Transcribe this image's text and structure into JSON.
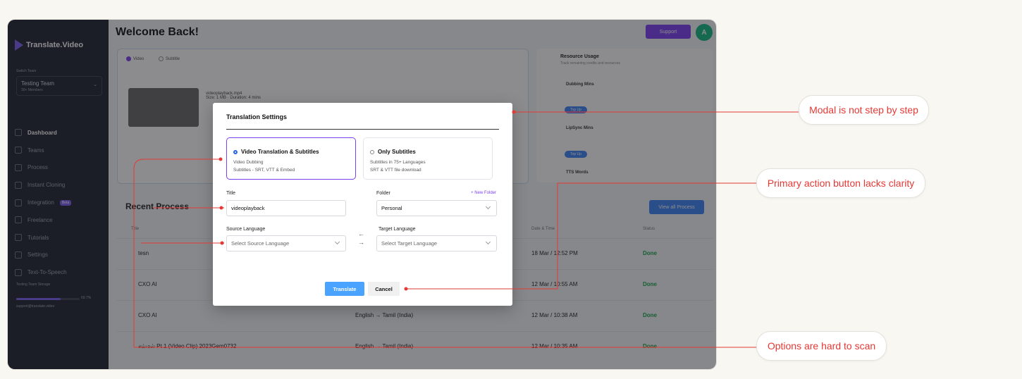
{
  "app": {
    "brand": "Translate.Video",
    "team_caption": "Switch Team",
    "team_name": "Testing Team",
    "team_sub": "30+ Members",
    "nav": [
      {
        "label": "Dashboard",
        "active": true
      },
      {
        "label": "Teams"
      },
      {
        "label": "Process"
      },
      {
        "label": "Instant Cloning"
      },
      {
        "label": "Integration",
        "badge": "Beta"
      },
      {
        "label": "Freelance"
      },
      {
        "label": "Tutorials"
      },
      {
        "label": "Settings"
      },
      {
        "label": "Text-To-Speech"
      }
    ],
    "usage_label": "Testing Team Storage",
    "usage_pct": "69.7%",
    "usage_email": "support@translate.video"
  },
  "header": {
    "welcome": "Welcome Back!",
    "support": "Support",
    "avatar_initial": "A"
  },
  "upload": {
    "radio_video": "Video",
    "radio_subtitle": "Subtitle",
    "file_name": "videoplayback.mp4",
    "file_meta": "Size: 1 MB · Duration: 4 mins"
  },
  "resources": {
    "title": "Resource Usage",
    "subtitle": "Track remaining credits and resources",
    "rows": [
      "Dubbing Mins",
      "LipSync Mins",
      "TTS Words"
    ],
    "button": "Top Up"
  },
  "recent": {
    "title": "Recent Process",
    "view_all": "View all Process",
    "headers": [
      "Title",
      "",
      "Date & Time",
      "Status"
    ],
    "rows": [
      {
        "title": "tesn",
        "lang": "",
        "date": "18 Mar / 12:52 PM",
        "status": "Done"
      },
      {
        "title": "CXO AI",
        "lang": "",
        "date": "12 Mar / 10:55 AM",
        "status": "Done"
      },
      {
        "title": "CXO AI",
        "lang": "English → Tamil (India)",
        "date": "12 Mar / 10:38 AM",
        "status": "Done"
      },
      {
        "title": "சம்மல் Pt 1 (Video Clip) 2023Gem0732",
        "lang": "English → Tamil (India)",
        "date": "12 Mar / 10:35 AM",
        "status": "Done"
      }
    ]
  },
  "modal": {
    "title": "Translation Settings",
    "option1": {
      "title": "Video Translation & Subtitles",
      "line1": "Video Dubbing",
      "line2": "Subtitles - SRT, VTT & Embed"
    },
    "option2": {
      "title": "Only Subtitles",
      "line1": "Subtitles in 75+ Languages",
      "line2": "SRT & VTT file download"
    },
    "title_label": "Title",
    "title_value": "videoplayback",
    "folder_label": "Folder",
    "new_folder": "+ New Folder",
    "folder_value": "Personal",
    "source_label": "Source Language",
    "source_placeholder": "Select Source Language",
    "target_label": "Target Language",
    "target_placeholder": "Select Target Language",
    "swap_left": "←",
    "swap_right": "→",
    "translate": "Translate",
    "cancel": "Cancel"
  },
  "annotations": {
    "color": "#e53935",
    "callouts": [
      "Modal is not step by step",
      "Primary action button lacks clarity",
      "Options are hard to scan"
    ]
  }
}
